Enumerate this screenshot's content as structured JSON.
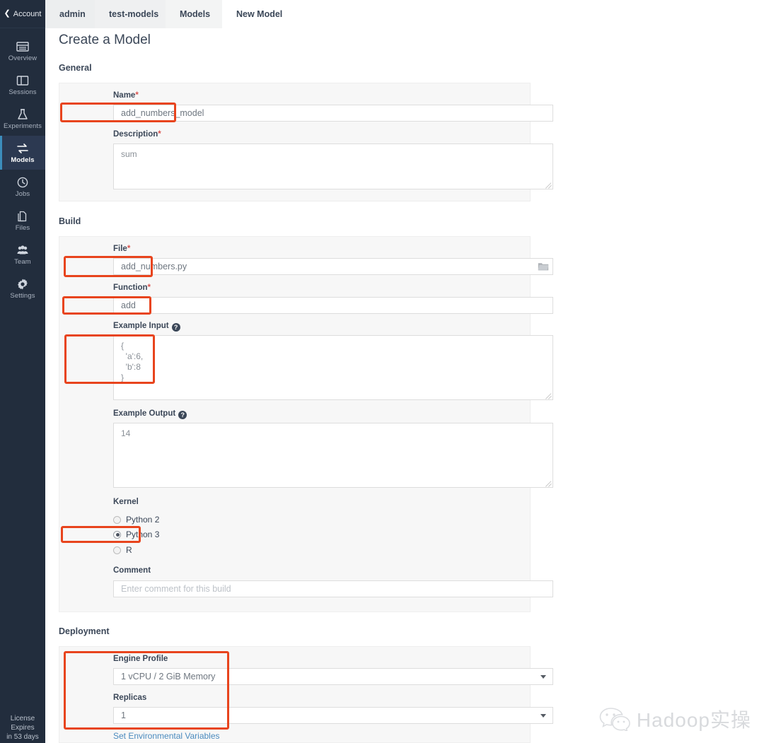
{
  "sidebar": {
    "account_label": "Account",
    "account_icon": "chevron-left-icon",
    "items": [
      {
        "label": "Overview",
        "icon": "overview-icon",
        "active": false
      },
      {
        "label": "Sessions",
        "icon": "sessions-icon",
        "active": false
      },
      {
        "label": "Experiments",
        "icon": "experiments-icon",
        "active": false
      },
      {
        "label": "Models",
        "icon": "models-icon",
        "active": true
      },
      {
        "label": "Jobs",
        "icon": "jobs-icon",
        "active": false
      },
      {
        "label": "Files",
        "icon": "files-icon",
        "active": false
      },
      {
        "label": "Team",
        "icon": "team-icon",
        "active": false
      },
      {
        "label": "Settings",
        "icon": "settings-icon",
        "active": false
      }
    ],
    "license": {
      "line1": "License",
      "line2": "Expires",
      "line3": "in 53 days"
    }
  },
  "breadcrumb": [
    {
      "label": "admin"
    },
    {
      "label": "test-models"
    },
    {
      "label": "Models"
    },
    {
      "label": "New Model"
    }
  ],
  "page": {
    "title": "Create a Model"
  },
  "sections": {
    "general": {
      "title": "General"
    },
    "build": {
      "title": "Build"
    },
    "deployment": {
      "title": "Deployment"
    }
  },
  "general": {
    "name": {
      "label": "Name",
      "required": "*",
      "value": "add_numbers_model",
      "placeholder": ""
    },
    "description": {
      "label": "Description",
      "required": "*",
      "value": "sum",
      "placeholder": ""
    }
  },
  "build": {
    "file": {
      "label": "File",
      "required": "*",
      "value": "add_numbers.py",
      "browse_icon": "folder-icon"
    },
    "function": {
      "label": "Function",
      "required": "*",
      "value": "add"
    },
    "example_input": {
      "label": "Example Input",
      "help_icon": "help-icon",
      "value": "{\n  'a':6,\n  'b':8\n}"
    },
    "example_output": {
      "label": "Example Output",
      "help_icon": "help-icon",
      "value": "14"
    },
    "kernel": {
      "label": "Kernel",
      "options": [
        {
          "label": "Python 2",
          "selected": false
        },
        {
          "label": "Python 3",
          "selected": true
        },
        {
          "label": "R",
          "selected": false
        }
      ]
    },
    "comment": {
      "label": "Comment",
      "value": "",
      "placeholder": "Enter comment for this build"
    }
  },
  "deployment": {
    "engine_profile": {
      "label": "Engine Profile",
      "value": "1 vCPU / 2 GiB Memory"
    },
    "replicas": {
      "label": "Replicas",
      "value": "1"
    },
    "env_link": "Set Environmental Variables"
  },
  "watermark": {
    "text": "Hadoop实操",
    "icon": "wechat-icon"
  },
  "colors": {
    "sidebar_bg": "#222d3d",
    "sidebar_active_bg": "#2c3951",
    "accent_blue": "#3c8dbc",
    "annotation_red": "#e8441d",
    "link_blue": "#4b8bbe",
    "required_red": "#d9534f",
    "panel_bg": "#f7f7f7"
  }
}
